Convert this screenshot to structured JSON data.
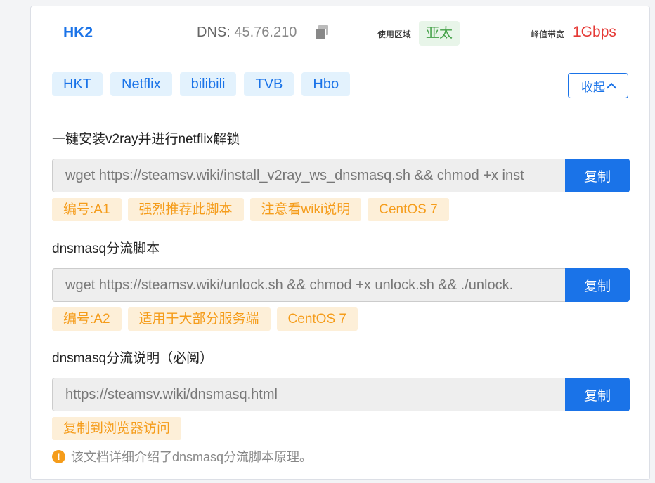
{
  "server": {
    "name": "HK2",
    "dns_label": "DNS:",
    "dns_value": "45.76.210",
    "region_label": "使用区域",
    "region_value": "亚太",
    "bandwidth_label": "峰值带宽",
    "bandwidth_value": "1Gbps"
  },
  "tags": [
    "HKT",
    "Netflix",
    "bilibili",
    "TVB",
    "Hbo"
  ],
  "collapse_label": "收起",
  "sections": [
    {
      "title": "一键安装v2ray并进行netflix解锁",
      "command": "wget https://steamsv.wiki/install_v2ray_ws_dnsmasq.sh && chmod +x inst",
      "copy_label": "复制",
      "badges": [
        "编号:A1",
        "强烈推荐此脚本",
        "注意看wiki说明",
        "CentOS 7"
      ]
    },
    {
      "title": "dnsmasq分流脚本",
      "command": "wget https://steamsv.wiki/unlock.sh && chmod +x unlock.sh && ./unlock.",
      "copy_label": "复制",
      "badges": [
        "编号:A2",
        "适用于大部分服务端",
        "CentOS 7"
      ]
    },
    {
      "title": "dnsmasq分流说明（必阅）",
      "command": "https://steamsv.wiki/dnsmasq.html",
      "copy_label": "复制",
      "badges": [
        "复制到浏览器访问"
      ]
    }
  ],
  "note": {
    "icon": "warning-icon",
    "text": "该文档详细介绍了dnsmasq分流脚本原理。"
  }
}
